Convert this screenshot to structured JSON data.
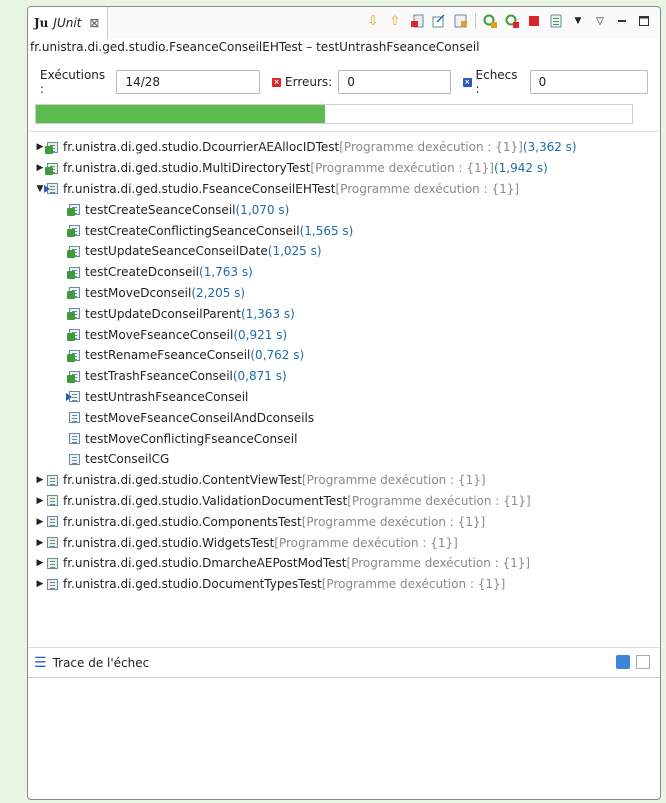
{
  "tab": {
    "icon_text": "Ju",
    "title": "JUnit",
    "close_glyph": "⊠"
  },
  "toolbar": {
    "icons": [
      "next-failure-icon",
      "prev-failure-icon",
      "show-failures-only-icon",
      "scroll-lock-icon",
      "history-icon",
      "rerun-icon",
      "rerun-failed-first-icon",
      "stop-icon",
      "test-run-history-icon",
      "dropdown-icon",
      "view-menu-icon",
      "minimize-icon",
      "maximize-icon"
    ]
  },
  "headline": "fr.unistra.di.ged.studio.FseanceConseilEHTest – testUntrashFseanceConseil",
  "counters": {
    "runs_label": "Exécutions :",
    "runs_value": "14/28",
    "errors_label": "Erreurs:",
    "errors_value": "0",
    "failures_label": "Echecs :",
    "failures_value": "0"
  },
  "progress": {
    "fraction": 0.485,
    "color": "#5bbb4f"
  },
  "tree": {
    "items": [
      {
        "level": 0,
        "arrow": "▶",
        "kind": "suite-ok",
        "name": "fr.unistra.di.ged.studio.DcourrierAEAllocIDTest",
        "meta": " [Programme dexécution : {1}]",
        "time": "(3,362 s)"
      },
      {
        "level": 0,
        "arrow": "▶",
        "kind": "suite-ok",
        "name": "fr.unistra.di.ged.studio.MultiDirectoryTest",
        "meta": " [Programme dexécution : {1}]",
        "time": "(1,942 s)"
      },
      {
        "level": 0,
        "arrow": "▼",
        "kind": "suite-run",
        "name": "fr.unistra.di.ged.studio.FseanceConseilEHTest",
        "meta": " [Programme dexécution : {1}]",
        "time": ""
      },
      {
        "level": 1,
        "arrow": "",
        "kind": "ok",
        "name": "testCreateSeanceConseil",
        "meta": "",
        "time": "(1,070 s)"
      },
      {
        "level": 1,
        "arrow": "",
        "kind": "ok",
        "name": "testCreateConflictingSeanceConseil",
        "meta": "",
        "time": "(1,565 s)"
      },
      {
        "level": 1,
        "arrow": "",
        "kind": "ok",
        "name": "testUpdateSeanceConseilDate",
        "meta": "",
        "time": "(1,025 s)"
      },
      {
        "level": 1,
        "arrow": "",
        "kind": "ok",
        "name": "testCreateDconseil",
        "meta": "",
        "time": "(1,763 s)"
      },
      {
        "level": 1,
        "arrow": "",
        "kind": "ok",
        "name": "testMoveDconseil",
        "meta": "",
        "time": "(2,205 s)"
      },
      {
        "level": 1,
        "arrow": "",
        "kind": "ok",
        "name": "testUpdateDconseilParent",
        "meta": "",
        "time": "(1,363 s)"
      },
      {
        "level": 1,
        "arrow": "",
        "kind": "ok",
        "name": "testMoveFseanceConseil",
        "meta": "",
        "time": "(0,921 s)"
      },
      {
        "level": 1,
        "arrow": "",
        "kind": "ok",
        "name": "testRenameFseanceConseil",
        "meta": "",
        "time": "(0,762 s)"
      },
      {
        "level": 1,
        "arrow": "",
        "kind": "ok",
        "name": "testTrashFseanceConseil",
        "meta": "",
        "time": "(0,871 s)"
      },
      {
        "level": 1,
        "arrow": "",
        "kind": "run",
        "name": "testUntrashFseanceConseil",
        "meta": "",
        "time": ""
      },
      {
        "level": 1,
        "arrow": "",
        "kind": "pending",
        "name": "testMoveFseanceConseilAndDconseils",
        "meta": "",
        "time": ""
      },
      {
        "level": 1,
        "arrow": "",
        "kind": "pending",
        "name": "testMoveConflictingFseanceConseil",
        "meta": "",
        "time": ""
      },
      {
        "level": 1,
        "arrow": "",
        "kind": "pending",
        "name": "testConseilCG",
        "meta": "",
        "time": ""
      },
      {
        "level": 0,
        "arrow": "▶",
        "kind": "suite-pending",
        "name": "fr.unistra.di.ged.studio.ContentViewTest",
        "meta": " [Programme dexécution : {1}]",
        "time": ""
      },
      {
        "level": 0,
        "arrow": "▶",
        "kind": "suite-pending",
        "name": "fr.unistra.di.ged.studio.ValidationDocumentTest",
        "meta": " [Programme dexécution : {1}]",
        "time": ""
      },
      {
        "level": 0,
        "arrow": "▶",
        "kind": "suite-pending",
        "name": "fr.unistra.di.ged.studio.ComponentsTest",
        "meta": " [Programme dexécution : {1}]",
        "time": ""
      },
      {
        "level": 0,
        "arrow": "▶",
        "kind": "suite-pending",
        "name": "fr.unistra.di.ged.studio.WidgetsTest",
        "meta": " [Programme dexécution : {1}]",
        "time": ""
      },
      {
        "level": 0,
        "arrow": "▶",
        "kind": "suite-pending",
        "name": "fr.unistra.di.ged.studio.DmarcheAEPostModTest",
        "meta": " [Programme dexécution : {1}]",
        "time": ""
      },
      {
        "level": 0,
        "arrow": "▶",
        "kind": "suite-pending",
        "name": "fr.unistra.di.ged.studio.DocumentTypesTest",
        "meta": " [Programme dexécution : {1}]",
        "time": ""
      }
    ]
  },
  "trace": {
    "title": "Trace de l'échec",
    "icons": [
      "filter-stack-icon",
      "compare-result-icon"
    ]
  }
}
